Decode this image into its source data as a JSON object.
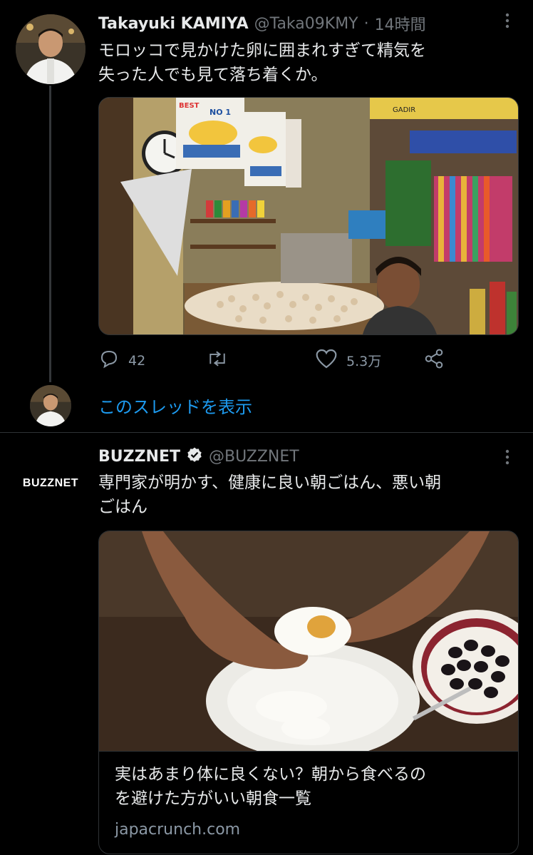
{
  "tweet1": {
    "name": "Takayuki KAMIYA",
    "handle": "@Taka09KMY",
    "sep": "·",
    "time": "14時間",
    "text_line1": "モロッコで見かけた卵に囲まれすぎて精気を",
    "text_line2": "失った人でも見て落ち着くか。",
    "replies": "42",
    "likes": "5.3万",
    "image_signs": [
      "BEST",
      "NO 1"
    ],
    "image_banner": "GADIR"
  },
  "thread": {
    "show_thread": "このスレッドを表示"
  },
  "tweet2": {
    "avatar_text": "BUZZNET",
    "name": "BUZZNET",
    "handle": "@BUZZNET",
    "text_line1": "専門家が明かす、健康に良い朝ごはん、悪い朝",
    "text_line2": "ごはん",
    "card_title_line1": "実はあまり体に良くない？朝から食べるの",
    "card_title_line2": "を避けた方がいい朝食一覧",
    "card_domain": "japacrunch.com"
  },
  "colors": {
    "accent": "#1d9bf0",
    "background": "#000000",
    "muted": "#71767b"
  },
  "icons": [
    "reply-icon",
    "retweet-icon",
    "like-icon",
    "share-icon",
    "more-icon",
    "verified-badge-icon"
  ]
}
